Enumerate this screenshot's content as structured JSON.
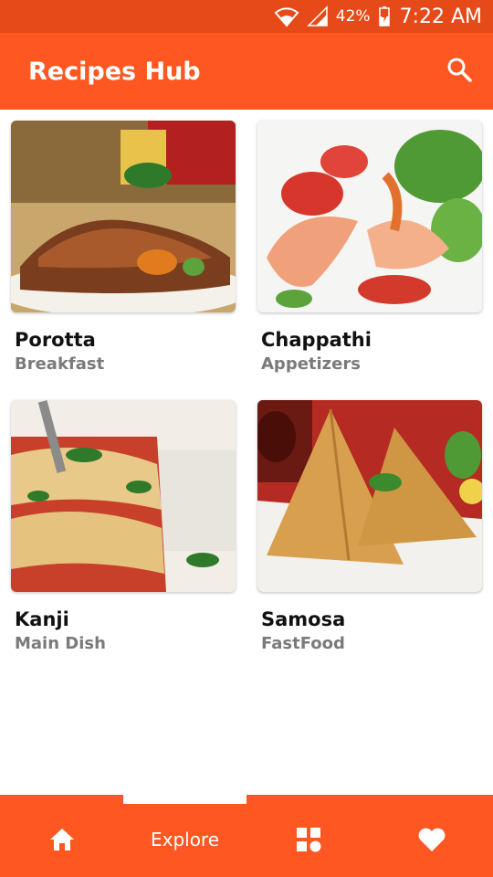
{
  "status_bar": {
    "battery_percent": "42%",
    "time": "7:22 AM",
    "icons": [
      "wifi-icon",
      "signal-icon",
      "battery-charging-icon"
    ]
  },
  "app_bar": {
    "title": "Recipes Hub",
    "search_icon": "search-icon"
  },
  "recipes": [
    {
      "name": "Porotta",
      "category": "Breakfast",
      "image": "grilled-meat-photo"
    },
    {
      "name": "Chappathi",
      "category": "Appetizers",
      "image": "shrimp-salad-photo"
    },
    {
      "name": "Kanji",
      "category": "Main Dish",
      "image": "lasagna-photo"
    },
    {
      "name": "Samosa",
      "category": "FastFood",
      "image": "samosa-photo"
    }
  ],
  "bottom_nav": {
    "items": [
      {
        "icon": "home-icon",
        "label": ""
      },
      {
        "icon": "",
        "label": "Explore",
        "selected": true
      },
      {
        "icon": "grid-icon",
        "label": ""
      },
      {
        "icon": "heart-icon",
        "label": ""
      }
    ]
  },
  "colors": {
    "primary": "#ff5722",
    "status_bar": "#e64a19"
  }
}
